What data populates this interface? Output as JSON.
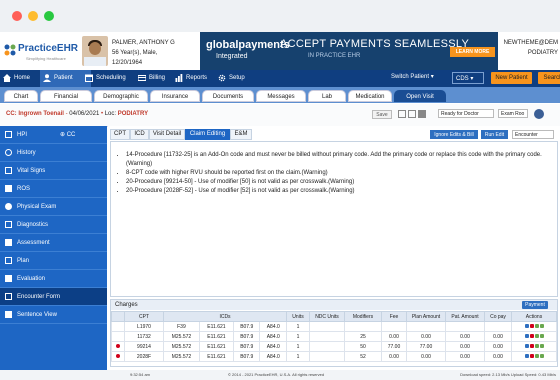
{
  "window": {
    "dots": [
      "#ff5f57",
      "#febc2e",
      "#28c840"
    ]
  },
  "logo": {
    "name": "PracticeEHR",
    "tagline": "Simplifying Healthcare"
  },
  "patient": {
    "name": "PALMER, ANTHONY G",
    "age_sex": "56 Year(s), Male,",
    "dob": "12/20/1964"
  },
  "ad": {
    "brand": "globalpayments",
    "brand2": "Integrated",
    "headline": "ACCEPT PAYMENTS SEAMLESSLY",
    "sub": "IN PRACTICE EHR",
    "cta": "LEARN MORE"
  },
  "user": {
    "line1": "NEWTHEME@DEM",
    "line2": "PODIATRY"
  },
  "mainnav": [
    {
      "label": "Home",
      "icon": "home-icon"
    },
    {
      "label": "Patient",
      "icon": "patient-icon"
    },
    {
      "label": "Scheduling",
      "icon": "calendar-icon"
    },
    {
      "label": "Billing",
      "icon": "billing-icon"
    },
    {
      "label": "Reports",
      "icon": "reports-icon"
    },
    {
      "label": "Setup",
      "icon": "gear-icon"
    }
  ],
  "nav_right": {
    "switch_patient": "Switch Patient",
    "cds": "CDS",
    "new_patient": "New Patient",
    "search": "Search"
  },
  "tabs": [
    "Chart",
    "Financial",
    "Demographic",
    "Insurance",
    "Documents",
    "Messages",
    "Lab",
    "Medication",
    "Open Visit"
  ],
  "encounter": {
    "cc": "CC:",
    "problem": "Ingrown Toenail",
    "date": "04/06/2021",
    "loc_label": "Loc:",
    "loc": "PODIATRY",
    "save": "Save",
    "status": "Ready for Doctor",
    "room": "Exam Roo"
  },
  "sidebar": [
    "HPI",
    "History",
    "Vital Signs",
    "ROS",
    "Physical Exam",
    "Diagnostics",
    "Assessment",
    "Plan",
    "Evaluation",
    "Encounter Form",
    "Sentence View"
  ],
  "subtabs": [
    "CPT",
    "ICD",
    "Visit Detail",
    "Claim Editing",
    "E&M"
  ],
  "claim_buttons": {
    "ignore": "Ignore Edits & Bill",
    "run": "Run Edit",
    "select": "Encounter"
  },
  "messages": [
    "14-Procedure [11732-25] is an Add-On code and must never be billed without primary code. Add the primary code or replace this code with the primary code. (Warning)",
    "8-CPT code with higher RVU should be reported first on the claim.(Warning)",
    "20-Procedure [99214-50] - Use of modifier [50] is not valid as per crosswalk.(Warning)",
    "20-Procedure [2028F-52] - Use of modifier [52] is not valid as per crosswalk.(Warning)"
  ],
  "charges": {
    "title": "Charges",
    "payment": "Payment",
    "headers": [
      "",
      "CPT",
      "ICDs",
      "",
      "",
      "",
      "Units",
      "NDC Units",
      "Modifiers",
      "Fee",
      "Plan Amount",
      "Pat. Amount",
      "Co pay",
      "Actions"
    ],
    "rows": [
      {
        "dot": false,
        "cpt": "L1970",
        "icds": [
          "F39",
          "E11.621",
          "B07.9",
          "A84.0"
        ],
        "units": "1",
        "ndc": "",
        "mod": "",
        "fee": "",
        "plan": "",
        "pat": "",
        "copay": ""
      },
      {
        "dot": false,
        "cpt": "11732",
        "icds": [
          "M25.572",
          "E11.621",
          "B07.9",
          "A84.0"
        ],
        "units": "1",
        "ndc": "",
        "mod": "25",
        "fee": "0.00",
        "plan": "0.00",
        "pat": "0.00",
        "copay": "0.00"
      },
      {
        "dot": true,
        "cpt": "99214",
        "icds": [
          "M25.572",
          "E11.621",
          "B07.9",
          "A84.0"
        ],
        "units": "1",
        "ndc": "",
        "mod": "50",
        "fee": "77.00",
        "plan": "77.00",
        "pat": "0.00",
        "copay": "0.00"
      },
      {
        "dot": true,
        "cpt": "2028F",
        "icds": [
          "M25.572",
          "E11.621",
          "B07.9",
          "A84.0"
        ],
        "units": "1",
        "ndc": "",
        "mod": "52",
        "fee": "0.00",
        "plan": "0.00",
        "pat": "0.00",
        "copay": "0.00"
      }
    ]
  },
  "footer": {
    "time": "9:32:54 am",
    "copyright": "© 2014 - 2021 PracticeEHR, U.S.A. All rights reserved",
    "speed": "Download speed: 2.13 Mb/s Upload Speed: 0.43 Mb/s"
  }
}
